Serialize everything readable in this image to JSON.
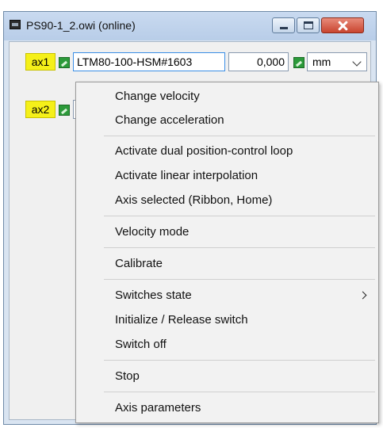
{
  "window": {
    "title": "PS90-1_2.owi (online)"
  },
  "axes": [
    {
      "tag": "ax1",
      "name": "LTM80-100-HSM#1603",
      "value": "0,000",
      "unit": "mm"
    },
    {
      "tag": "ax2"
    }
  ],
  "context_menu": {
    "items": [
      {
        "label": "Change velocity"
      },
      {
        "label": "Change acceleration"
      },
      {
        "label": "Activate dual position-control loop"
      },
      {
        "label": "Activate linear interpolation"
      },
      {
        "label": "Axis selected (Ribbon, Home)"
      },
      {
        "label": "Velocity mode"
      },
      {
        "label": "Calibrate"
      },
      {
        "label": "Switches state"
      },
      {
        "label": "Initialize / Release switch"
      },
      {
        "label": "Switch off"
      },
      {
        "label": "Stop"
      },
      {
        "label": "Axis parameters"
      }
    ]
  },
  "colors": {
    "axis_tag": "#f5f019",
    "link_icon": "#2c9a3a",
    "close_button": "#c94530"
  }
}
